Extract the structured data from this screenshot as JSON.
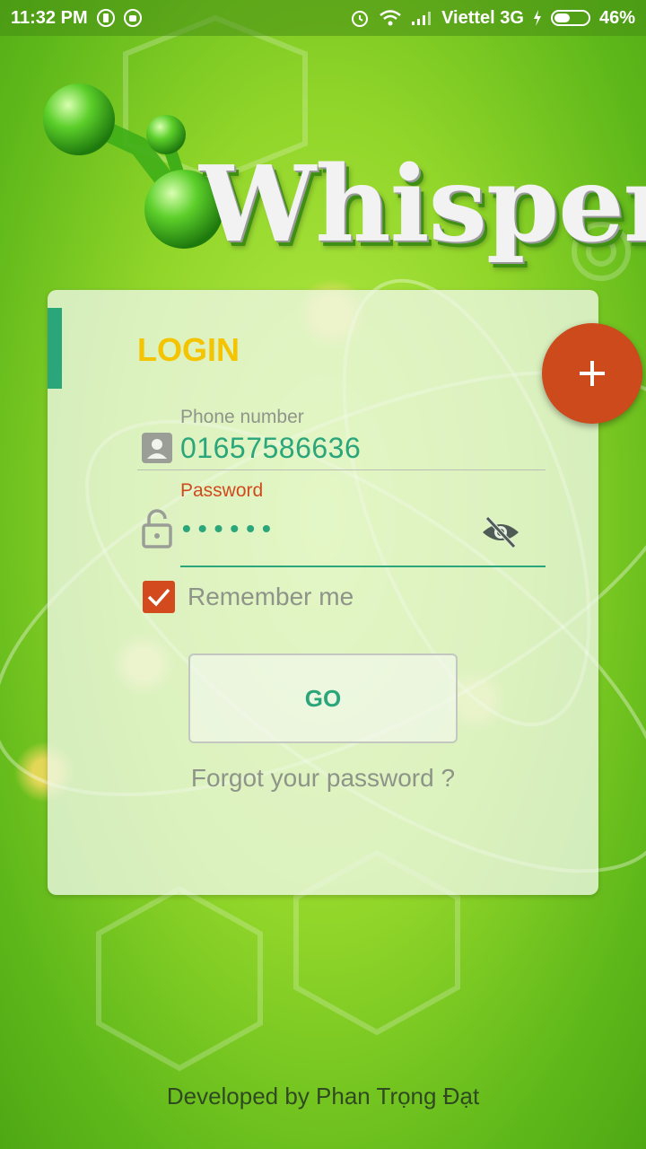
{
  "status_bar": {
    "time": "11:32 PM",
    "carrier": "Viettel 3G",
    "battery_percent": "46%",
    "battery_level": 0.46,
    "icons": [
      "phone-status-icon",
      "android-icon",
      "alarm-icon",
      "wifi-icon",
      "signal-icon",
      "charging-icon",
      "battery-icon"
    ]
  },
  "app": {
    "logo_text": "Whisper"
  },
  "login_card": {
    "title": "LOGIN",
    "phone": {
      "label": "Phone number",
      "value": "01657586636",
      "icon": "person-icon"
    },
    "password": {
      "label": "Password",
      "masked_value": "••••••",
      "icon": "lock-icon",
      "toggle_icon": "eye-off-icon"
    },
    "remember": {
      "label": "Remember me",
      "checked": true
    },
    "go_button": "GO",
    "forgot_link": "Forgot your password ?"
  },
  "fab": {
    "icon": "plus-icon"
  },
  "footer": {
    "credit": "Developed by Phan Trọng Đạt"
  },
  "colors": {
    "accent_green": "#2aa67a",
    "title_yellow": "#f5c400",
    "alert_orange": "#cc4a1c",
    "background_green": "#92d62a"
  }
}
